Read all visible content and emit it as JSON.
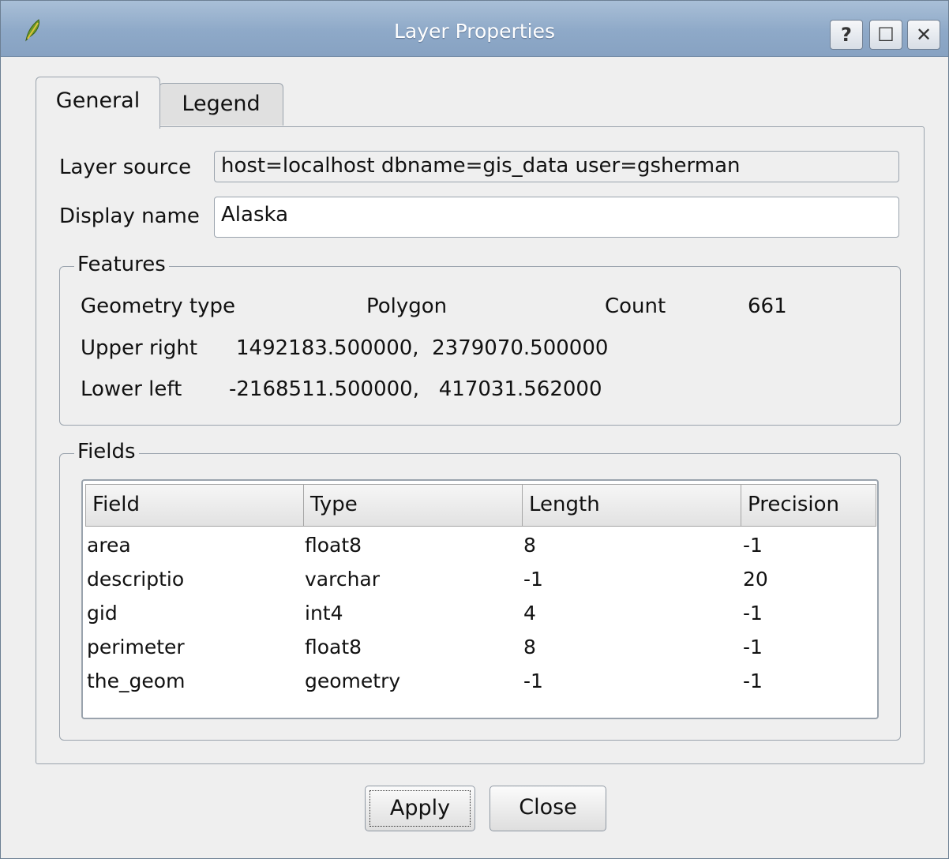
{
  "window": {
    "title": "Layer Properties",
    "help_label": "?",
    "maximize_label": "☐",
    "close_label": "✕"
  },
  "tabs": [
    {
      "label": "General",
      "active": true
    },
    {
      "label": "Legend",
      "active": false
    }
  ],
  "general": {
    "layer_source_label": "Layer source",
    "layer_source_value": "host=localhost dbname=gis_data user=gsherman",
    "display_name_label": "Display name",
    "display_name_value": "Alaska"
  },
  "features": {
    "title": "Features",
    "geometry_type_label": "Geometry type",
    "geometry_type_value": "Polygon",
    "count_label": "Count",
    "count_value": "661",
    "upper_right_label": "Upper right",
    "upper_right_value": "1492183.500000,  2379070.500000",
    "lower_left_label": "Lower left",
    "lower_left_value": "-2168511.500000,   417031.562000"
  },
  "fields": {
    "title": "Fields",
    "columns": [
      "Field",
      "Type",
      "Length",
      "Precision"
    ],
    "rows": [
      [
        "area",
        "float8",
        "8",
        "-1"
      ],
      [
        "descriptio",
        "varchar",
        "-1",
        "20"
      ],
      [
        "gid",
        "int4",
        "4",
        "-1"
      ],
      [
        "perimeter",
        "float8",
        "8",
        "-1"
      ],
      [
        "the_geom",
        "geometry",
        "-1",
        "-1"
      ]
    ]
  },
  "buttons": {
    "apply_label": "Apply",
    "close_label": "Close"
  }
}
